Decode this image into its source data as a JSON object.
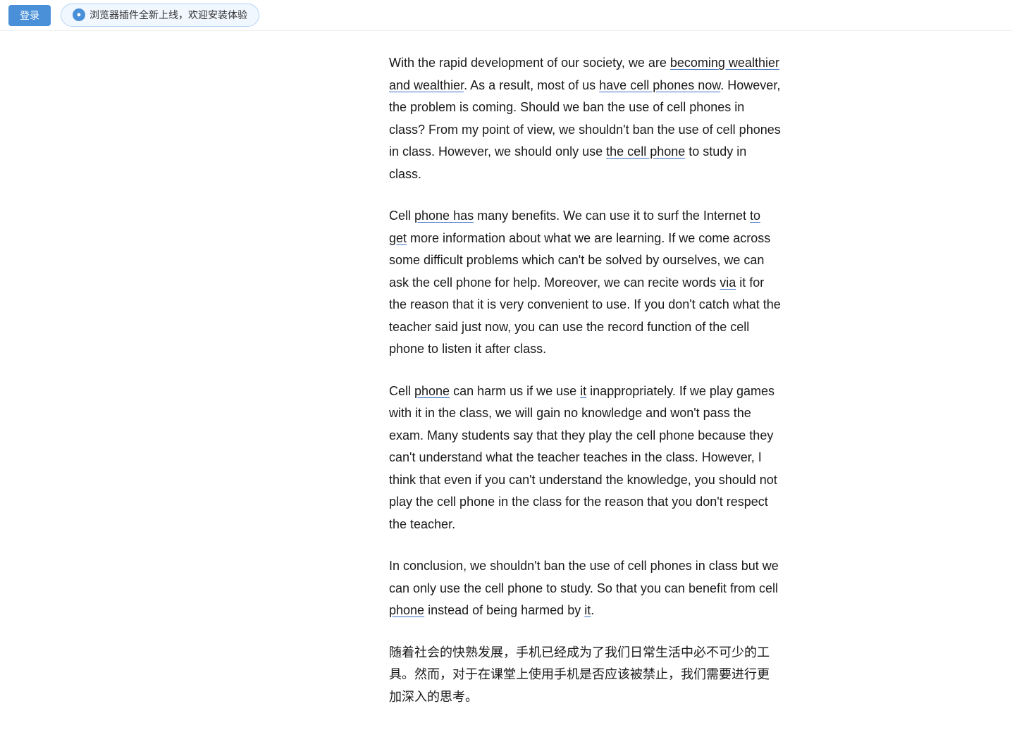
{
  "topbar": {
    "login_label": "登录",
    "plugin_notice": "浏览器插件全新上线，欢迎安装体验"
  },
  "content": {
    "paragraphs": [
      {
        "id": "p1",
        "text_parts": [
          {
            "text": "With the rapid development of our society, we are ",
            "style": "normal"
          },
          {
            "text": "becoming wealthier and wealthier",
            "style": "underline-blue"
          },
          {
            "text": ". As a result, most of us ",
            "style": "normal"
          },
          {
            "text": "have cell phones now",
            "style": "underline-blue"
          },
          {
            "text": ". However, the problem is coming. Should we ban the use of cell phones in class? From my point of view, we shouldn’t ban the use of cell phones in class. However, we should only use ",
            "style": "normal"
          },
          {
            "text": "the cell phone",
            "style": "underline-blue"
          },
          {
            "text": " to study in class.",
            "style": "normal"
          }
        ]
      },
      {
        "id": "p2",
        "text_parts": [
          {
            "text": "Cell ",
            "style": "normal"
          },
          {
            "text": "phone has",
            "style": "underline-blue"
          },
          {
            "text": " many benefits. We can use it to surf the Internet ",
            "style": "normal"
          },
          {
            "text": "to get",
            "style": "underline-blue"
          },
          {
            "text": " more information about what we are learning. If we come across some difficult problems which can’t be solved by ourselves, we can ask the cell phone for help. Moreover, we can recite words ",
            "style": "normal"
          },
          {
            "text": "via",
            "style": "underline-blue"
          },
          {
            "text": " it for the reason that it is very convenient to use. If you don’t catch what the teacher said just now, you can use the record function of the cell phone to listen it after class.",
            "style": "normal"
          }
        ]
      },
      {
        "id": "p3",
        "text_parts": [
          {
            "text": "Cell ",
            "style": "normal"
          },
          {
            "text": "phone",
            "style": "underline-blue"
          },
          {
            "text": " can harm us if we use ",
            "style": "normal"
          },
          {
            "text": "it",
            "style": "underline-blue"
          },
          {
            "text": " inappropriately. If we play games with it in the class, we will gain no knowledge and won’t pass the exam. Many students say that they play the cell phone because they can’t understand what the teacher teaches in the class. However, I ",
            "style": "normal"
          },
          {
            "text": "think that even",
            "style": "normal"
          },
          {
            "text": " if you can’t understand the knowledge, you should not play the cell phone in the class for the reason that you don’t respect the teacher.",
            "style": "normal"
          }
        ]
      },
      {
        "id": "p4",
        "text_parts": [
          {
            "text": "In conclusion, we shouldn’t ban the use of cell phones in class but we can only use the cell phone to study. So that you can benefit from cell ",
            "style": "normal"
          },
          {
            "text": "phone",
            "style": "underline-blue"
          },
          {
            "text": " instead of being harmed by ",
            "style": "normal"
          },
          {
            "text": "it",
            "style": "underline-blue"
          },
          {
            "text": ".",
            "style": "normal"
          }
        ]
      },
      {
        "id": "p5-zh",
        "text_parts": [
          {
            "text": "随着社会的快熟发展，手机已经成为了我们日常生活中必不可少的工具。然而，对于在课堂上使用手机是否应该被禁止，我们需要进行更加深入的思考。",
            "style": "normal"
          }
        ]
      }
    ]
  }
}
